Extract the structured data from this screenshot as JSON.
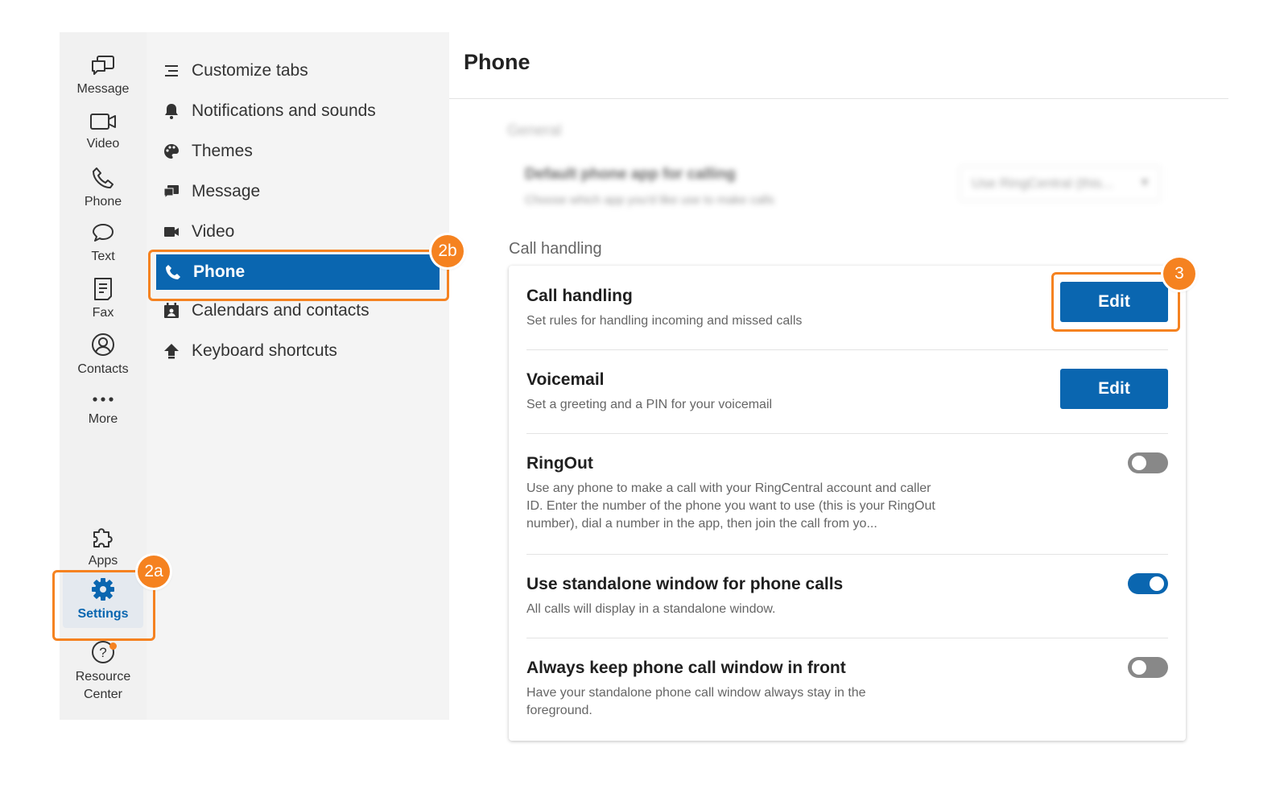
{
  "rail": {
    "items": [
      {
        "label": "Message",
        "icon": "message-icon"
      },
      {
        "label": "Video",
        "icon": "video-icon"
      },
      {
        "label": "Phone",
        "icon": "phone-icon"
      },
      {
        "label": "Text",
        "icon": "text-bubble-icon"
      },
      {
        "label": "Fax",
        "icon": "fax-icon"
      },
      {
        "label": "Contacts",
        "icon": "contacts-icon"
      },
      {
        "label": "More",
        "icon": "more-dots-icon"
      }
    ],
    "apps_label": "Apps",
    "settings_label": "Settings",
    "resource_center_label_1": "Resource",
    "resource_center_label_2": "Center"
  },
  "settings_nav": {
    "items": [
      {
        "label": "Customize tabs",
        "icon": "customize-tabs-icon"
      },
      {
        "label": "Notifications and sounds",
        "icon": "bell-icon"
      },
      {
        "label": "Themes",
        "icon": "palette-icon"
      },
      {
        "label": "Message",
        "icon": "message-icon"
      },
      {
        "label": "Video",
        "icon": "video-camera-icon"
      },
      {
        "label": "Phone",
        "icon": "phone-icon",
        "active": true
      },
      {
        "label": "Calendars and contacts",
        "icon": "calendar-contacts-icon"
      },
      {
        "label": "Keyboard shortcuts",
        "icon": "keyboard-shortcut-icon"
      }
    ]
  },
  "main": {
    "title": "Phone",
    "general": {
      "label": "General",
      "title": "Default phone app for calling",
      "desc": "Choose which app you'd like use to make calls",
      "select_value": "Use RingCentral (this..."
    },
    "section_label": "Call handling",
    "rows": [
      {
        "title": "Call handling",
        "desc": "Set rules for handling incoming and missed calls",
        "button": "Edit"
      },
      {
        "title": "Voicemail",
        "desc": "Set a greeting and a PIN for your voicemail",
        "button": "Edit"
      },
      {
        "title": "RingOut",
        "desc": "Use any phone to make a call with your RingCentral account and caller ID. Enter the number of the phone you want to use (this is your RingOut number), dial a number in the app, then join the call from yo...",
        "toggle": false
      },
      {
        "title": "Use standalone window for phone calls",
        "desc": "All calls will display in a standalone window.",
        "toggle": true
      },
      {
        "title": "Always keep phone call window in front",
        "desc": "Have your standalone phone call window always stay in the foreground.",
        "toggle": false
      }
    ]
  },
  "callouts": {
    "a": "2a",
    "b": "2b",
    "c": "3"
  },
  "colors": {
    "accent": "#0a66b0",
    "callout": "#f58220",
    "rail_bg": "#f1f1f1",
    "nav_bg": "#f4f4f4"
  }
}
